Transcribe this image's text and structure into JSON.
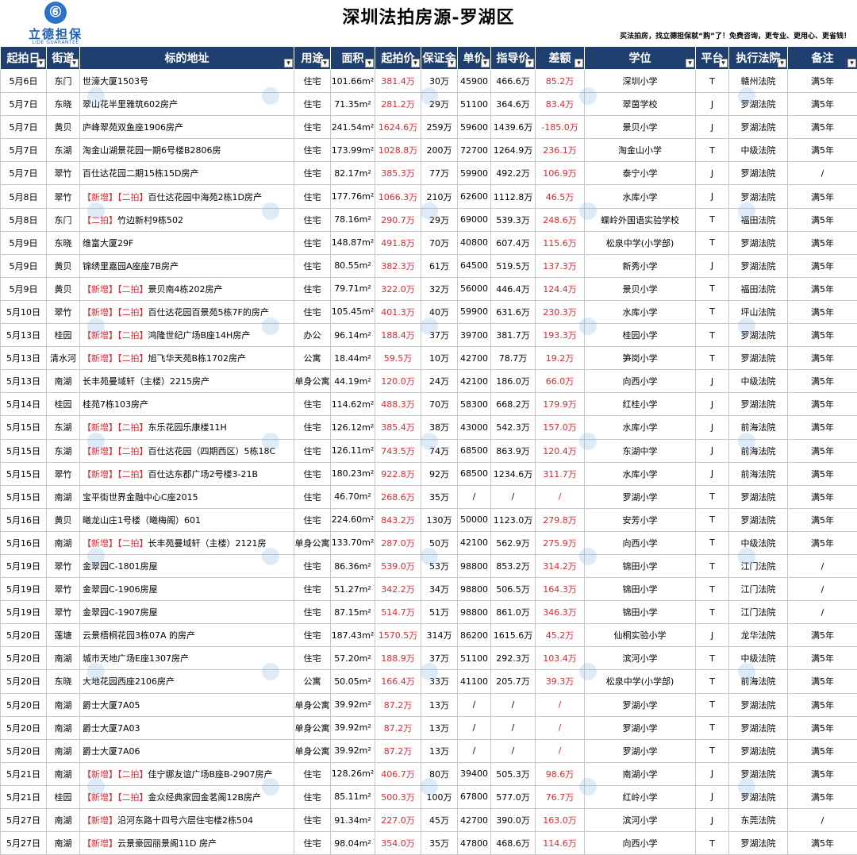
{
  "logo": {
    "cn": "立德担保",
    "en": "LIDE GUARANTEE",
    "mark": "⑥"
  },
  "title": "深圳法拍房源-罗湖区",
  "slogan": "买法拍房，找立德担保就“购”了！免费咨询，更专业、更用心、更省钱！",
  "columns": [
    "起拍日",
    "街道",
    "标的地址",
    "用途",
    "面积",
    "起拍价",
    "保证金",
    "单价",
    "指导价",
    "差额",
    "学位",
    "平台",
    "执行法院",
    "备注"
  ],
  "tags": {
    "new": "【新增】",
    "second": "【二拍】"
  },
  "rows": [
    {
      "date": "5月6日",
      "street": "东门",
      "new": "",
      "second": "",
      "addr": "世濠大厦1503号",
      "use": "住宅",
      "area": "101.66m²",
      "start": "381.4万",
      "deposit": "30万",
      "unit": "45900",
      "guide": "466.6万",
      "diff": "85.2万",
      "school": "深圳小学",
      "platform": "T",
      "court": "赣州法院",
      "note": "满5年"
    },
    {
      "date": "5月7日",
      "street": "东晓",
      "new": "",
      "second": "",
      "addr": "翠山花半里雅筑602房产",
      "use": "住宅",
      "area": "71.35m²",
      "start": "281.2万",
      "deposit": "29万",
      "unit": "51100",
      "guide": "364.6万",
      "diff": "83.4万",
      "school": "翠茵学校",
      "platform": "J",
      "court": "罗湖法院",
      "note": "满5年"
    },
    {
      "date": "5月7日",
      "street": "黄贝",
      "new": "",
      "second": "",
      "addr": "庐峰翠苑双鱼座1906房产",
      "use": "住宅",
      "area": "241.54m²",
      "start": "1624.6万",
      "deposit": "259万",
      "unit": "59600",
      "guide": "1439.6万",
      "diff": "-185.0万",
      "school": "景贝小学",
      "platform": "J",
      "court": "罗湖法院",
      "note": "满5年"
    },
    {
      "date": "5月7日",
      "street": "东湖",
      "new": "",
      "second": "",
      "addr": "淘金山湖景花园一期6号楼B2806房",
      "use": "住宅",
      "area": "173.99m²",
      "start": "1028.8万",
      "deposit": "200万",
      "unit": "72700",
      "guide": "1264.9万",
      "diff": "236.1万",
      "school": "淘金山小学",
      "platform": "T",
      "court": "中级法院",
      "note": "满5年"
    },
    {
      "date": "5月7日",
      "street": "翠竹",
      "new": "",
      "second": "",
      "addr": "百仕达花园二期15栋15D房产",
      "use": "住宅",
      "area": "82.17m²",
      "start": "385.3万",
      "deposit": "77万",
      "unit": "59900",
      "guide": "492.2万",
      "diff": "106.9万",
      "school": "泰宁小学",
      "platform": "J",
      "court": "罗湖法院",
      "note": "/"
    },
    {
      "date": "5月8日",
      "street": "翠竹",
      "new": "【新增】",
      "second": "【二拍】",
      "addr": "百仕达花园中海苑2栋1D房产",
      "use": "住宅",
      "area": "177.76m²",
      "start": "1066.3万",
      "deposit": "210万",
      "unit": "62600",
      "guide": "1112.8万",
      "diff": "46.5万",
      "school": "水库小学",
      "platform": "J",
      "court": "罗湖法院",
      "note": "满5年"
    },
    {
      "date": "5月8日",
      "street": "东门",
      "new": "",
      "second": "【二拍】",
      "addr": "竹边新村9栋502",
      "use": "住宅",
      "area": "78.16m²",
      "start": "290.7万",
      "deposit": "29万",
      "unit": "69000",
      "guide": "539.3万",
      "diff": "248.6万",
      "school": "蝶岭外国语实验学校",
      "platform": "T",
      "court": "福田法院",
      "note": "满5年"
    },
    {
      "date": "5月9日",
      "street": "东晓",
      "new": "",
      "second": "",
      "addr": "维富大厦29F",
      "use": "住宅",
      "area": "148.87m²",
      "start": "491.8万",
      "deposit": "70万",
      "unit": "40800",
      "guide": "607.4万",
      "diff": "115.6万",
      "school": "松泉中学(小学部)",
      "platform": "T",
      "court": "罗湖法院",
      "note": "满5年"
    },
    {
      "date": "5月9日",
      "street": "黄贝",
      "new": "",
      "second": "",
      "addr": "锦绣里嘉园A座座7B房产",
      "use": "住宅",
      "area": "80.55m²",
      "start": "382.3万",
      "deposit": "61万",
      "unit": "64500",
      "guide": "519.5万",
      "diff": "137.3万",
      "school": "新秀小学",
      "platform": "J",
      "court": "罗湖法院",
      "note": "满5年"
    },
    {
      "date": "5月9日",
      "street": "黄贝",
      "new": "【新增】",
      "second": "【二拍】",
      "addr": "景贝南4栋202房产",
      "use": "住宅",
      "area": "79.71m²",
      "start": "322.0万",
      "deposit": "32万",
      "unit": "56000",
      "guide": "446.4万",
      "diff": "124.4万",
      "school": "景贝小学",
      "platform": "T",
      "court": "福田法院",
      "note": "满5年"
    },
    {
      "date": "5月10日",
      "street": "翠竹",
      "new": "【新增】",
      "second": "【二拍】",
      "addr": "百仕达花园百景苑5栋7F的房产",
      "use": "住宅",
      "area": "105.45m²",
      "start": "401.3万",
      "deposit": "40万",
      "unit": "59900",
      "guide": "631.6万",
      "diff": "230.3万",
      "school": "水库小学",
      "platform": "T",
      "court": "坪山法院",
      "note": "满5年"
    },
    {
      "date": "5月13日",
      "street": "桂园",
      "new": "【新增】",
      "second": "【二拍】",
      "addr": "鸿隆世纪广场B座14H房产",
      "use": "办公",
      "area": "96.14m²",
      "start": "188.4万",
      "deposit": "37万",
      "unit": "39700",
      "guide": "381.7万",
      "diff": "193.3万",
      "school": "桂园小学",
      "platform": "T",
      "court": "罗湖法院",
      "note": "满5年"
    },
    {
      "date": "5月13日",
      "street": "清水河",
      "new": "【新增】",
      "second": "【二拍】",
      "addr": "旭飞华天苑B栋1702房产",
      "use": "公寓",
      "area": "18.44m²",
      "start": "59.5万",
      "deposit": "10万",
      "unit": "42700",
      "guide": "78.7万",
      "diff": "19.2万",
      "school": "笋岗小学",
      "platform": "T",
      "court": "罗湖法院",
      "note": "满5年"
    },
    {
      "date": "5月13日",
      "street": "南湖",
      "new": "",
      "second": "",
      "addr": "长丰苑曼域轩（主楼）2215房产",
      "use": "单身公寓",
      "area": "44.19m²",
      "start": "120.0万",
      "deposit": "24万",
      "unit": "42100",
      "guide": "186.0万",
      "diff": "66.0万",
      "school": "向西小学",
      "platform": "J",
      "court": "中级法院",
      "note": "满5年"
    },
    {
      "date": "5月14日",
      "street": "桂园",
      "new": "",
      "second": "",
      "addr": "桂苑7栋103房产",
      "use": "住宅",
      "area": "114.62m²",
      "start": "488.3万",
      "deposit": "70万",
      "unit": "58300",
      "guide": "668.2万",
      "diff": "179.9万",
      "school": "红桂小学",
      "platform": "J",
      "court": "罗湖法院",
      "note": "满5年"
    },
    {
      "date": "5月15日",
      "street": "东湖",
      "new": "【新增】",
      "second": "【二拍】",
      "addr": "东乐花园乐康楼11H",
      "use": "住宅",
      "area": "126.12m²",
      "start": "385.4万",
      "deposit": "38万",
      "unit": "43000",
      "guide": "542.3万",
      "diff": "157.0万",
      "school": "水库小学",
      "platform": "J",
      "court": "前海法院",
      "note": "满5年"
    },
    {
      "date": "5月15日",
      "street": "东湖",
      "new": "【新增】",
      "second": "【二拍】",
      "addr": "百仕达花园（四期西区）5栋18C",
      "use": "住宅",
      "area": "126.11m²",
      "start": "743.5万",
      "deposit": "74万",
      "unit": "68500",
      "guide": "863.9万",
      "diff": "120.4万",
      "school": "东湖中学",
      "platform": "J",
      "court": "前海法院",
      "note": "满5年"
    },
    {
      "date": "5月15日",
      "street": "翠竹",
      "new": "【新增】",
      "second": "【二拍】",
      "addr": "百仕达东郡广场2号楼3-21B",
      "use": "住宅",
      "area": "180.23m²",
      "start": "922.8万",
      "deposit": "92万",
      "unit": "68500",
      "guide": "1234.6万",
      "diff": "311.7万",
      "school": "水库小学",
      "platform": "J",
      "court": "前海法院",
      "note": "满5年"
    },
    {
      "date": "5月15日",
      "street": "南湖",
      "new": "",
      "second": "",
      "addr": "宝平街世界金融中心C座2015",
      "use": "住宅",
      "area": "46.70m²",
      "start": "268.6万",
      "deposit": "35万",
      "unit": "/",
      "guide": "/",
      "diff": "/",
      "school": "罗湖小学",
      "platform": "T",
      "court": "罗湖法院",
      "note": "满5年"
    },
    {
      "date": "5月16日",
      "street": "黄贝",
      "new": "",
      "second": "",
      "addr": "曦龙山庄1号楼（曦梅阁）601",
      "use": "住宅",
      "area": "224.60m²",
      "start": "843.2万",
      "deposit": "130万",
      "unit": "50000",
      "guide": "1123.0万",
      "diff": "279.8万",
      "school": "安芳小学",
      "platform": "T",
      "court": "罗湖法院",
      "note": "满5年"
    },
    {
      "date": "5月16日",
      "street": "南湖",
      "new": "【新增】",
      "second": "【二拍】",
      "addr": "长丰苑曼域轩（主楼）2121房",
      "use": "单身公寓",
      "area": "133.70m²",
      "start": "287.0万",
      "deposit": "50万",
      "unit": "42100",
      "guide": "562.9万",
      "diff": "275.9万",
      "school": "向西小学",
      "platform": "T",
      "court": "中级法院",
      "note": "满5年"
    },
    {
      "date": "5月19日",
      "street": "翠竹",
      "new": "",
      "second": "",
      "addr": "金翠园C-1801房屋",
      "use": "住宅",
      "area": "86.36m²",
      "start": "539.0万",
      "deposit": "53万",
      "unit": "98800",
      "guide": "853.2万",
      "diff": "314.2万",
      "school": "锦田小学",
      "platform": "T",
      "court": "江门法院",
      "note": "/"
    },
    {
      "date": "5月19日",
      "street": "翠竹",
      "new": "",
      "second": "",
      "addr": "金翠园C-1906房屋",
      "use": "住宅",
      "area": "51.27m²",
      "start": "342.2万",
      "deposit": "34万",
      "unit": "98800",
      "guide": "506.5万",
      "diff": "164.3万",
      "school": "锦田小学",
      "platform": "T",
      "court": "江门法院",
      "note": "/"
    },
    {
      "date": "5月19日",
      "street": "翠竹",
      "new": "",
      "second": "",
      "addr": "金翠园C-1907房屋",
      "use": "住宅",
      "area": "87.15m²",
      "start": "514.7万",
      "deposit": "51万",
      "unit": "98800",
      "guide": "861.0万",
      "diff": "346.3万",
      "school": "锦田小学",
      "platform": "T",
      "court": "江门法院",
      "note": "/"
    },
    {
      "date": "5月20日",
      "street": "莲塘",
      "new": "",
      "second": "",
      "addr": "云景梧桐花园3栋07A 的房产",
      "use": "住宅",
      "area": "187.43m²",
      "start": "1570.5万",
      "deposit": "314万",
      "unit": "86200",
      "guide": "1615.6万",
      "diff": "45.2万",
      "school": "仙桐实验小学",
      "platform": "J",
      "court": "龙华法院",
      "note": "满5年"
    },
    {
      "date": "5月20日",
      "street": "南湖",
      "new": "",
      "second": "",
      "addr": "城市天地广场E座1307房产",
      "use": "住宅",
      "area": "57.20m²",
      "start": "188.9万",
      "deposit": "37万",
      "unit": "51100",
      "guide": "292.3万",
      "diff": "103.4万",
      "school": "滨河小学",
      "platform": "T",
      "court": "中级法院",
      "note": "满5年"
    },
    {
      "date": "5月20日",
      "street": "东晓",
      "new": "",
      "second": "",
      "addr": "大地花园西座2106房产",
      "use": "公寓",
      "area": "50.05m²",
      "start": "166.4万",
      "deposit": "33万",
      "unit": "41100",
      "guide": "205.7万",
      "diff": "39.3万",
      "school": "松泉中学(小学部)",
      "platform": "T",
      "court": "前海法院",
      "note": "满5年"
    },
    {
      "date": "5月20日",
      "street": "南湖",
      "new": "",
      "second": "",
      "addr": "爵士大厦7A05",
      "use": "单身公寓",
      "area": "39.92m²",
      "start": "87.2万",
      "deposit": "13万",
      "unit": "/",
      "guide": "/",
      "diff": "/",
      "school": "罗湖小学",
      "platform": "T",
      "court": "罗湖法院",
      "note": "满5年"
    },
    {
      "date": "5月20日",
      "street": "南湖",
      "new": "",
      "second": "",
      "addr": "爵士大厦7A03",
      "use": "单身公寓",
      "area": "39.92m²",
      "start": "87.2万",
      "deposit": "13万",
      "unit": "/",
      "guide": "/",
      "diff": "/",
      "school": "罗湖小学",
      "platform": "T",
      "court": "罗湖法院",
      "note": "满5年"
    },
    {
      "date": "5月20日",
      "street": "南湖",
      "new": "",
      "second": "",
      "addr": "爵士大厦7A06",
      "use": "单身公寓",
      "area": "39.92m²",
      "start": "87.2万",
      "deposit": "13万",
      "unit": "/",
      "guide": "/",
      "diff": "/",
      "school": "罗湖小学",
      "platform": "T",
      "court": "罗湖法院",
      "note": "满5年"
    },
    {
      "date": "5月21日",
      "street": "南湖",
      "new": "【新增】",
      "second": "【二拍】",
      "addr": "佳宁娜友谊广场B座B-2907房产",
      "use": "住宅",
      "area": "128.26m²",
      "start": "406.7万",
      "deposit": "80万",
      "unit": "39400",
      "guide": "505.3万",
      "diff": "98.6万",
      "school": "南湖小学",
      "platform": "J",
      "court": "罗湖法院",
      "note": "满5年"
    },
    {
      "date": "5月21日",
      "street": "桂园",
      "new": "【新增】",
      "second": "【二拍】",
      "addr": "金众经典家园金茗阁12B房产",
      "use": "住宅",
      "area": "85.11m²",
      "start": "500.3万",
      "deposit": "100万",
      "unit": "67800",
      "guide": "577.0万",
      "diff": "76.7万",
      "school": "红岭小学",
      "platform": "J",
      "court": "罗湖法院",
      "note": "满5年"
    },
    {
      "date": "5月27日",
      "street": "南湖",
      "new": "【新增】",
      "second": "",
      "addr": "沿河东路十四号六层住宅楼2栋504",
      "use": "住宅",
      "area": "91.34m²",
      "start": "227.0万",
      "deposit": "45万",
      "unit": "42700",
      "guide": "390.0万",
      "diff": "163.0万",
      "school": "滨河小学",
      "platform": "J",
      "court": "东莞法院",
      "note": "/"
    },
    {
      "date": "5月27日",
      "street": "南湖",
      "new": "【新增】",
      "second": "",
      "addr": "云景豪园丽景阁11D 房产",
      "use": "住宅",
      "area": "98.04m²",
      "start": "354.0万",
      "deposit": "35万",
      "unit": "47800",
      "guide": "468.6万",
      "diff": "114.6万",
      "school": "向西小学",
      "platform": "T",
      "court": "罗湖法院",
      "note": "满5年"
    }
  ]
}
